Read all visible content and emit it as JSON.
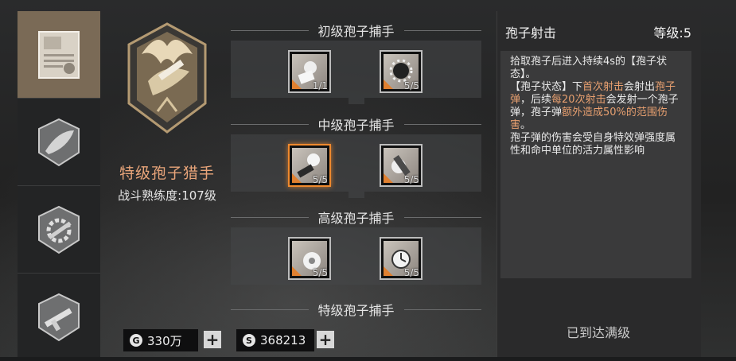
{
  "class": {
    "name": "特级孢子猎手",
    "proficiency": "战斗熟练度:107级"
  },
  "sidebar": {
    "items": [
      {
        "icon": "certificate-icon",
        "active": true
      },
      {
        "icon": "leaf-shield-icon",
        "active": false
      },
      {
        "icon": "gear-wrench-icon",
        "active": false
      },
      {
        "icon": "firearm-icon",
        "active": false
      }
    ]
  },
  "tiers": [
    {
      "title": "初级孢子捕手",
      "skills": [
        {
          "icon": "spore-hand-icon",
          "level": "1/1"
        },
        {
          "icon": "spore-burst-icon",
          "level": "5/5"
        }
      ]
    },
    {
      "title": "中级孢子捕手",
      "skills": [
        {
          "icon": "spore-shot-icon",
          "level": "5/5",
          "selected": true
        },
        {
          "icon": "spore-blade-icon",
          "level": "5/5"
        }
      ]
    },
    {
      "title": "高级孢子捕手",
      "skills": [
        {
          "icon": "spore-orb-icon",
          "level": "5/5"
        },
        {
          "icon": "spore-timer-icon",
          "level": "5/5"
        }
      ]
    },
    {
      "title": "特级孢子捕手",
      "skills": []
    }
  ],
  "currency": {
    "gold": {
      "symbol": "G",
      "value": "330万"
    },
    "silver": {
      "symbol": "S",
      "value": "368213"
    }
  },
  "detail": {
    "name": "孢子射击",
    "level": "等级:5",
    "desc": {
      "p1": "拾取孢子后进入持续4s的【孢子状态】。",
      "p2a": "【孢子状态】下",
      "p2b": "首次射击",
      "p2c": "会射出",
      "p2d": "孢子弹",
      "p2e": "，后续",
      "p2f": "每20次射击",
      "p2g": "会发射一个孢子弹，孢子弹",
      "p2h": "额外造成50%的范围伤害",
      "p2i": "。",
      "p3": "孢子弹的伤害会受自身特效弹强度属性和命中单位的活力属性影响"
    },
    "status": "已到达满级"
  },
  "colors": {
    "accent": "#e8a070",
    "selected": "#f08a2e",
    "rail_active": "#7a6a56"
  }
}
